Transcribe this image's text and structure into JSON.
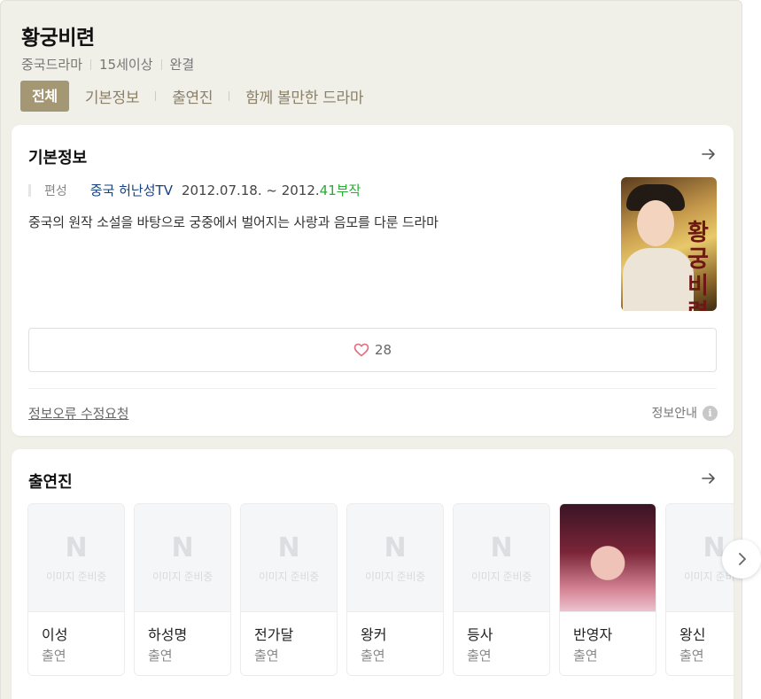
{
  "header": {
    "title": "황궁비련",
    "meta": [
      "중국드라마",
      "15세이상",
      "완결"
    ],
    "tabs": [
      "전체",
      "기본정보",
      "출연진",
      "함께 볼만한 드라마"
    ]
  },
  "basic_info": {
    "title": "기본정보",
    "label": "편성",
    "channel": "중국 허난성TV",
    "dates": "2012.07.18. ~ 2012.",
    "episodes": "41부작",
    "description": "중국의 원작 소설을 바탕으로 궁중에서 벌어지는 사랑과 음모를 다룬 드라마",
    "poster_calligraphy": "황궁비련",
    "likes": "28",
    "report_link": "정보오류 수정요청",
    "info_guide": "정보안내"
  },
  "cast_section": {
    "title": "출연진",
    "placeholder_letter": "N",
    "placeholder_text": "이미지 준비중",
    "members": [
      {
        "name": "이성",
        "role": "출연",
        "has_photo": false
      },
      {
        "name": "하성명",
        "role": "출연",
        "has_photo": false
      },
      {
        "name": "전가달",
        "role": "출연",
        "has_photo": false
      },
      {
        "name": "왕커",
        "role": "출연",
        "has_photo": false
      },
      {
        "name": "등사",
        "role": "출연",
        "has_photo": false
      },
      {
        "name": "반영자",
        "role": "출연",
        "has_photo": true
      },
      {
        "name": "왕신",
        "role": "출연",
        "has_photo": false
      }
    ]
  },
  "colors": {
    "panel_bg": "#f0efe8",
    "tab_active_bg": "#a39774",
    "channel_link": "#16427f",
    "episodes_green": "#2aab35",
    "heart_pink": "#e06b7d"
  }
}
